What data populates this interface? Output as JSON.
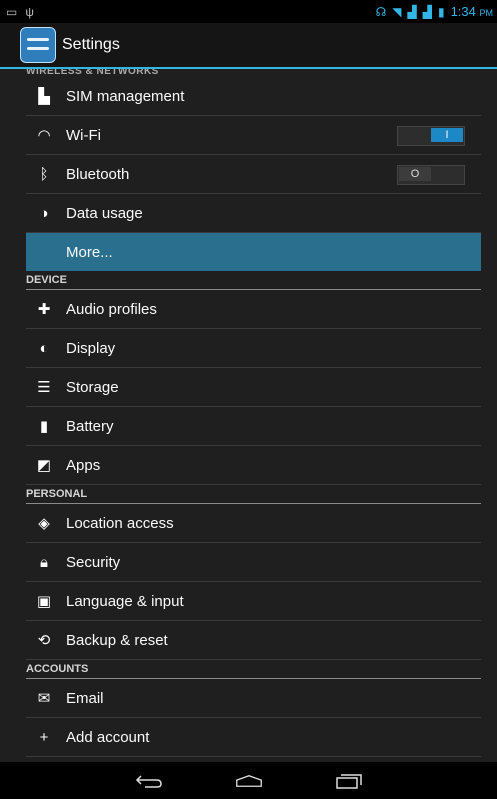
{
  "statusbar": {
    "time": "1:34",
    "ampm": "PM"
  },
  "actionbar": {
    "title": "Settings"
  },
  "cut_section": "WIRELESS & NETWORKS",
  "wireless": [
    {
      "label": "SIM management",
      "icon": "sim-icon"
    },
    {
      "label": "Wi-Fi",
      "icon": "wifi-icon",
      "toggle": "on",
      "toggle_text": "I"
    },
    {
      "label": "Bluetooth",
      "icon": "bluetooth-icon",
      "toggle": "off",
      "toggle_text": "O"
    },
    {
      "label": "Data usage",
      "icon": "data-usage-icon"
    },
    {
      "label": "More...",
      "icon": "",
      "selected": true
    }
  ],
  "device_header": "DEVICE",
  "device": [
    {
      "label": "Audio profiles",
      "icon": "audio-profiles-icon"
    },
    {
      "label": "Display",
      "icon": "display-icon"
    },
    {
      "label": "Storage",
      "icon": "storage-icon"
    },
    {
      "label": "Battery",
      "icon": "battery-icon"
    },
    {
      "label": "Apps",
      "icon": "apps-icon"
    }
  ],
  "personal_header": "PERSONAL",
  "personal": [
    {
      "label": "Location access",
      "icon": "location-icon"
    },
    {
      "label": "Security",
      "icon": "lock-icon"
    },
    {
      "label": "Language & input",
      "icon": "language-icon"
    },
    {
      "label": "Backup & reset",
      "icon": "backup-icon"
    }
  ],
  "accounts_header": "ACCOUNTS",
  "accounts": [
    {
      "label": "Email",
      "icon": "email-icon"
    },
    {
      "label": "Add account",
      "icon": "add-icon"
    }
  ],
  "colors": {
    "accent": "#33b5e5",
    "selected": "#2a6f8e"
  }
}
